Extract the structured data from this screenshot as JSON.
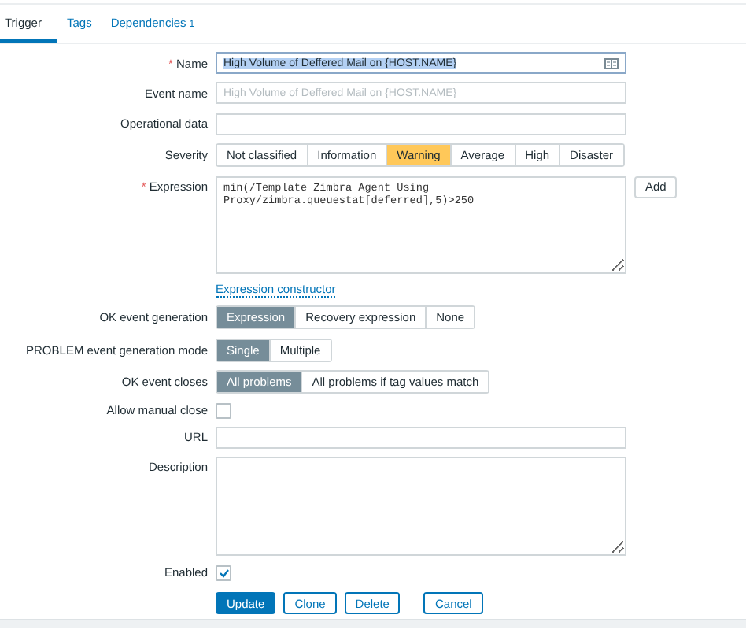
{
  "tabs": [
    {
      "label": "Trigger",
      "selected": true
    },
    {
      "label": "Tags",
      "selected": false
    },
    {
      "label": "Dependencies",
      "selected": false,
      "count": "1"
    }
  ],
  "form": {
    "rows": [
      {
        "kind": "text",
        "label": "Name",
        "required_mark": "*",
        "value": "High Volume of Deffered Mail on {HOST.NAME}",
        "text_selected": true
      },
      {
        "kind": "text",
        "label": "Event name",
        "placeholder": "High Volume of Deffered Mail on {HOST.NAME}"
      },
      {
        "kind": "text",
        "label": "Operational data"
      },
      {
        "kind": "severity",
        "label": "Severity",
        "options": [
          {
            "label": "Not classified",
            "selected": false
          },
          {
            "label": "Information",
            "selected": false
          },
          {
            "label": "Warning",
            "selected": true
          },
          {
            "label": "Average",
            "selected": false
          },
          {
            "label": "High",
            "selected": false
          },
          {
            "label": "Disaster",
            "selected": false
          }
        ]
      },
      {
        "kind": "textarea",
        "label": "Expression",
        "required_mark": "*",
        "value": "min(/Template Zimbra Agent Using Proxy/zimbra.queuestat[deferred],5)>250",
        "button": "Add",
        "link": "Expression constructor"
      },
      {
        "kind": "segmented",
        "label": "OK event generation",
        "options": [
          {
            "label": "Expression",
            "selected": true
          },
          {
            "label": "Recovery expression",
            "selected": false
          },
          {
            "label": "None",
            "selected": false
          }
        ]
      },
      {
        "kind": "segmented",
        "label": "PROBLEM event generation mode",
        "options": [
          {
            "label": "Single",
            "selected": true
          },
          {
            "label": "Multiple",
            "selected": false
          }
        ]
      },
      {
        "kind": "segmented",
        "label": "OK event closes",
        "options": [
          {
            "label": "All problems",
            "selected": true
          },
          {
            "label": "All problems if tag values match",
            "selected": false
          }
        ]
      },
      {
        "kind": "checkbox",
        "label": "Allow manual close",
        "checked": false
      },
      {
        "kind": "text",
        "label": "URL"
      },
      {
        "kind": "textarea",
        "label": "Description"
      },
      {
        "kind": "checkbox",
        "label": "Enabled",
        "checked": true
      }
    ],
    "buttons": [
      {
        "label": "Update",
        "primary": true
      },
      {
        "label": "Clone",
        "primary": false
      },
      {
        "label": "Delete",
        "primary": false
      },
      {
        "label": "Cancel",
        "primary": false
      }
    ]
  }
}
